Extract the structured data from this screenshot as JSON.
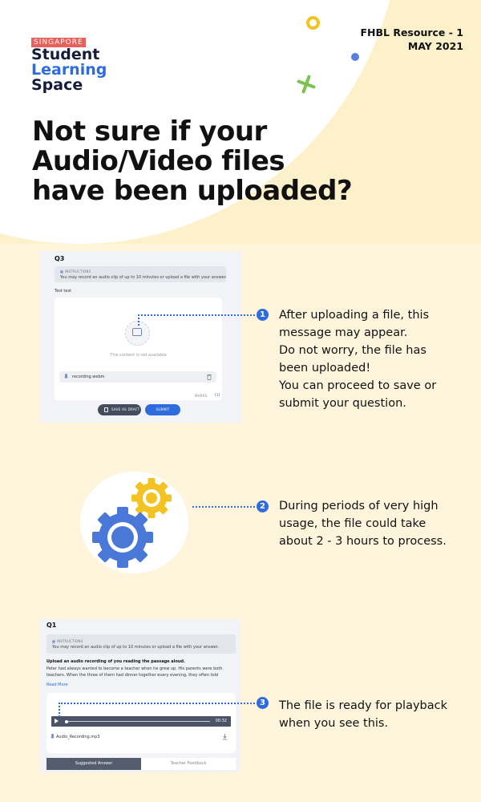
{
  "header": {
    "logo": {
      "tag": "SINGAPORE",
      "line1": "Student",
      "line2": "Learning",
      "line3": "Space"
    },
    "resource_id": "FHBL Resource - 1",
    "resource_date": "MAY 2021",
    "headline": [
      "Not sure if your",
      "Audio/Video files",
      "have been uploaded?"
    ]
  },
  "shot1": {
    "question": "Q3",
    "instructions_title": "INSTRUCTIONS",
    "instructions_text": "You may record an audio clip of up to 10 minutes or upload a file with your answer.",
    "prompt": "Test test",
    "unavailable_text": "This content is not available",
    "file_name": "recording.webm",
    "marks_label": "MARKS",
    "marks_value": "[1]",
    "save_draft_label": "SAVE AS DRAFT",
    "submit_label": "SUBMIT"
  },
  "steps": [
    {
      "number": "1",
      "lines": [
        "After uploading a file, this",
        "message may appear.",
        "Do not worry, the file has",
        "been uploaded!",
        "You can proceed to save or",
        "submit your question."
      ]
    },
    {
      "number": "2",
      "lines": [
        "During periods of very high",
        "usage, the file could take",
        "about 2 - 3 hours to process."
      ]
    },
    {
      "number": "3",
      "lines": [
        "The file is ready for playback",
        "when you see this."
      ]
    }
  ],
  "shot3": {
    "question": "Q1",
    "instructions_title": "INSTRUCTIONS",
    "instructions_text": "You may record an audio clip of up to 10 minutes or upload a file with your answer.",
    "task_title": "Upload an audio recording of you reading the passage aloud.",
    "task_body_1": "Peter had always wanted to become a teacher when he grew up. His parents were both",
    "task_body_2": "teachers. When the three of them had dinner together every evening, they often told",
    "read_more": "Read More",
    "player_time": "00:32",
    "audio_file": "Audio_Recording.mp3",
    "tab_suggested": "Suggested Answer",
    "tab_feedback": "Teacher Feedback"
  },
  "colors": {
    "background": "#fef5dc",
    "accent_blue": "#2e6bdc",
    "accent_yellow": "#f3c324",
    "accent_green": "#7cc24e",
    "logo_red": "#e8605a"
  },
  "icons": [
    "gear-icon",
    "image-placeholder-icon",
    "microphone-icon",
    "trash-icon",
    "save-icon",
    "play-icon",
    "download-icon"
  ]
}
